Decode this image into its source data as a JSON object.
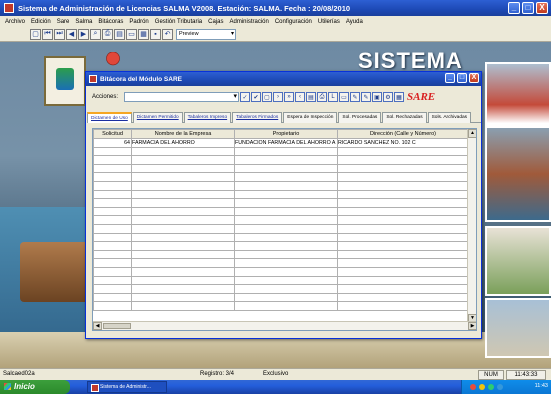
{
  "app": {
    "title": "Sistema de Administración de Licencias SALMA V2008. Estación: SALMA. Fecha : 20/08/2010",
    "window_buttons": [
      "_",
      "□",
      "X"
    ]
  },
  "menu": [
    "Archivo",
    "Edición",
    "Sare",
    "Salma",
    "Bitácoras",
    "Padrón",
    "Gestión Tributaria",
    "Cajas",
    "Administración",
    "Configuración",
    "Utilerías",
    "Ayuda"
  ],
  "toolbar": {
    "preview_value": "Preview"
  },
  "background": {
    "banner_text": "SISTEMA"
  },
  "child_window": {
    "title": "Bitácora del Módulo SARE",
    "actions_label": "Acciones:",
    "logo_text": "SARE",
    "tabs": [
      {
        "label": "Dictamen de Uso"
      },
      {
        "label": "Dictamen Permitido"
      },
      {
        "label": "Tabaleros Impreso"
      },
      {
        "label": "Tabaleros Firmados"
      },
      {
        "label": "Espera de Inspección"
      },
      {
        "label": "Sol. Procesadas"
      },
      {
        "label": "Sol. Rechazadas"
      },
      {
        "label": "Sols. Archivadas"
      }
    ],
    "columns": [
      "Solicitud",
      "Nombre de la Empresa",
      "Propietario",
      "Dirección (Calle y Número)"
    ],
    "rows": [
      [
        "64",
        "FARMACIA DEL AHORRO",
        "FUNDACION FARMACIA DEL AHORRO A",
        "RICARDO SANCHEZ NO. 102 C"
      ]
    ]
  },
  "status": {
    "user": "Salcaed02a",
    "record": "Registro: 3/4",
    "mode": "Exclusivo",
    "num": "NUM",
    "time": "11:43:33"
  },
  "taskbar": {
    "start": "Inicio",
    "task": "Sistema de Administr...",
    "clock": "11:43"
  }
}
